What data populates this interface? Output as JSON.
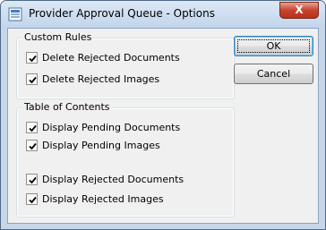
{
  "window": {
    "title": "Provider Approval Queue - Options",
    "close_glyph": "X",
    "icon": "app-list-icon"
  },
  "custom_rules": {
    "title": "Custom Rules",
    "items": [
      {
        "label": "Delete Rejected Documents",
        "checked": true
      },
      {
        "label": "Delete Rejected Images",
        "checked": true
      }
    ]
  },
  "toc": {
    "title": "Table of Contents",
    "items": [
      {
        "label": "Display Pending Documents",
        "checked": true
      },
      {
        "label": "Display Pending Images",
        "checked": true
      },
      {
        "label": "Display Rejected Documents",
        "checked": true
      },
      {
        "label": "Display Rejected Images",
        "checked": true
      }
    ]
  },
  "buttons": {
    "ok_label": "OK",
    "cancel_label": "Cancel"
  },
  "colors": {
    "frame": "#c6d7ea",
    "close_button": "#c7432f",
    "dialog_bg": "#f0f0f0"
  }
}
